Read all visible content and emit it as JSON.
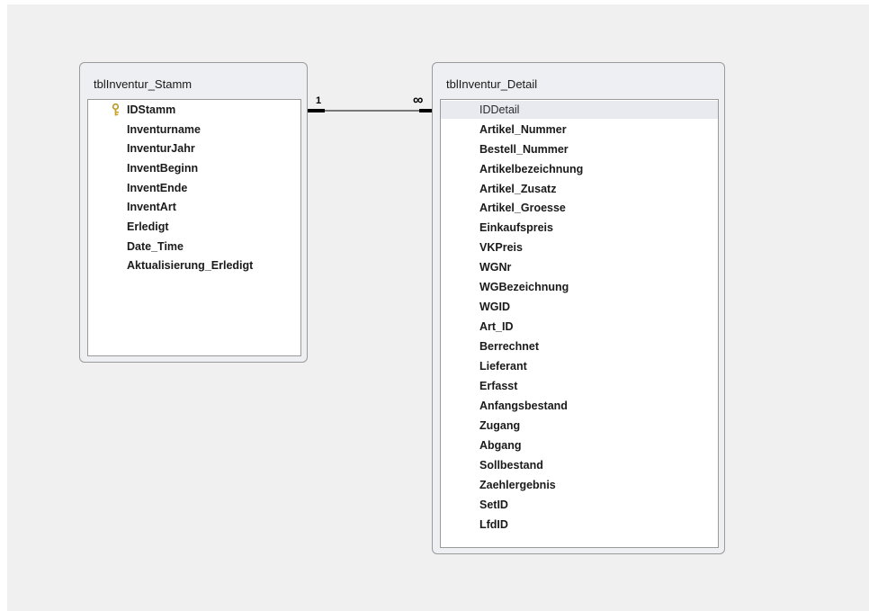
{
  "tables": [
    {
      "name": "tblInventur_Stamm",
      "fields": [
        {
          "label": "IDStamm",
          "primary_key": true
        },
        {
          "label": "Inventurname"
        },
        {
          "label": "InventurJahr"
        },
        {
          "label": "InventBeginn"
        },
        {
          "label": "InventEnde"
        },
        {
          "label": "InventArt"
        },
        {
          "label": "Erledigt"
        },
        {
          "label": "Date_Time"
        },
        {
          "label": "Aktualisierung_Erledigt"
        }
      ]
    },
    {
      "name": "tblInventur_Detail",
      "fields": [
        {
          "label": "IDDetail",
          "selected": true
        },
        {
          "label": "Artikel_Nummer"
        },
        {
          "label": "Bestell_Nummer"
        },
        {
          "label": "Artikelbezeichnung"
        },
        {
          "label": "Artikel_Zusatz"
        },
        {
          "label": "Artikel_Groesse"
        },
        {
          "label": "Einkaufspreis"
        },
        {
          "label": "VKPreis"
        },
        {
          "label": "WGNr"
        },
        {
          "label": "WGBezeichnung"
        },
        {
          "label": "WGID"
        },
        {
          "label": "Art_ID"
        },
        {
          "label": "Berrechnet"
        },
        {
          "label": "Lieferant"
        },
        {
          "label": "Erfasst"
        },
        {
          "label": "Anfangsbestand"
        },
        {
          "label": "Zugang"
        },
        {
          "label": "Abgang"
        },
        {
          "label": "Sollbestand"
        },
        {
          "label": "Zaehlergebnis"
        },
        {
          "label": "SetID"
        },
        {
          "label": "LfdID"
        }
      ]
    }
  ],
  "relationship": {
    "one_side_label": "1",
    "many_side_label": "∞"
  },
  "colors": {
    "canvas": "#f0f0f0",
    "table_frame": "#eeeff2",
    "border": "#9a9a9a",
    "selected_row": "#e8eaf0",
    "key_icon": "#c9a227"
  },
  "icons": {
    "primary_key": "key-icon"
  }
}
